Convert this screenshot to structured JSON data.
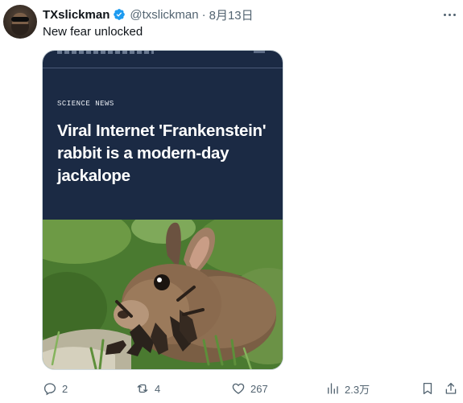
{
  "tweet": {
    "author_name": "TXslickman",
    "handle": "@txslickman",
    "separator": "·",
    "date": "8月13日",
    "text": "New fear unlocked",
    "verified_icon": "verified-badge-icon"
  },
  "article_card": {
    "kicker": "SCIENCE NEWS",
    "headline": "Viral Internet 'Frankenstein' rabbit is a modern-day jackalope",
    "background_color": "#1b2a44"
  },
  "actions": {
    "reply_count": "2",
    "repost_count": "4",
    "like_count": "267",
    "views_count": "2.3万"
  },
  "icons": [
    "more-icon",
    "reply-icon",
    "repost-icon",
    "like-icon",
    "views-icon",
    "bookmark-icon",
    "share-icon"
  ],
  "colors": {
    "verified": "#1d9bf0",
    "secondary_text": "#536471",
    "primary_text": "#0f1419"
  }
}
